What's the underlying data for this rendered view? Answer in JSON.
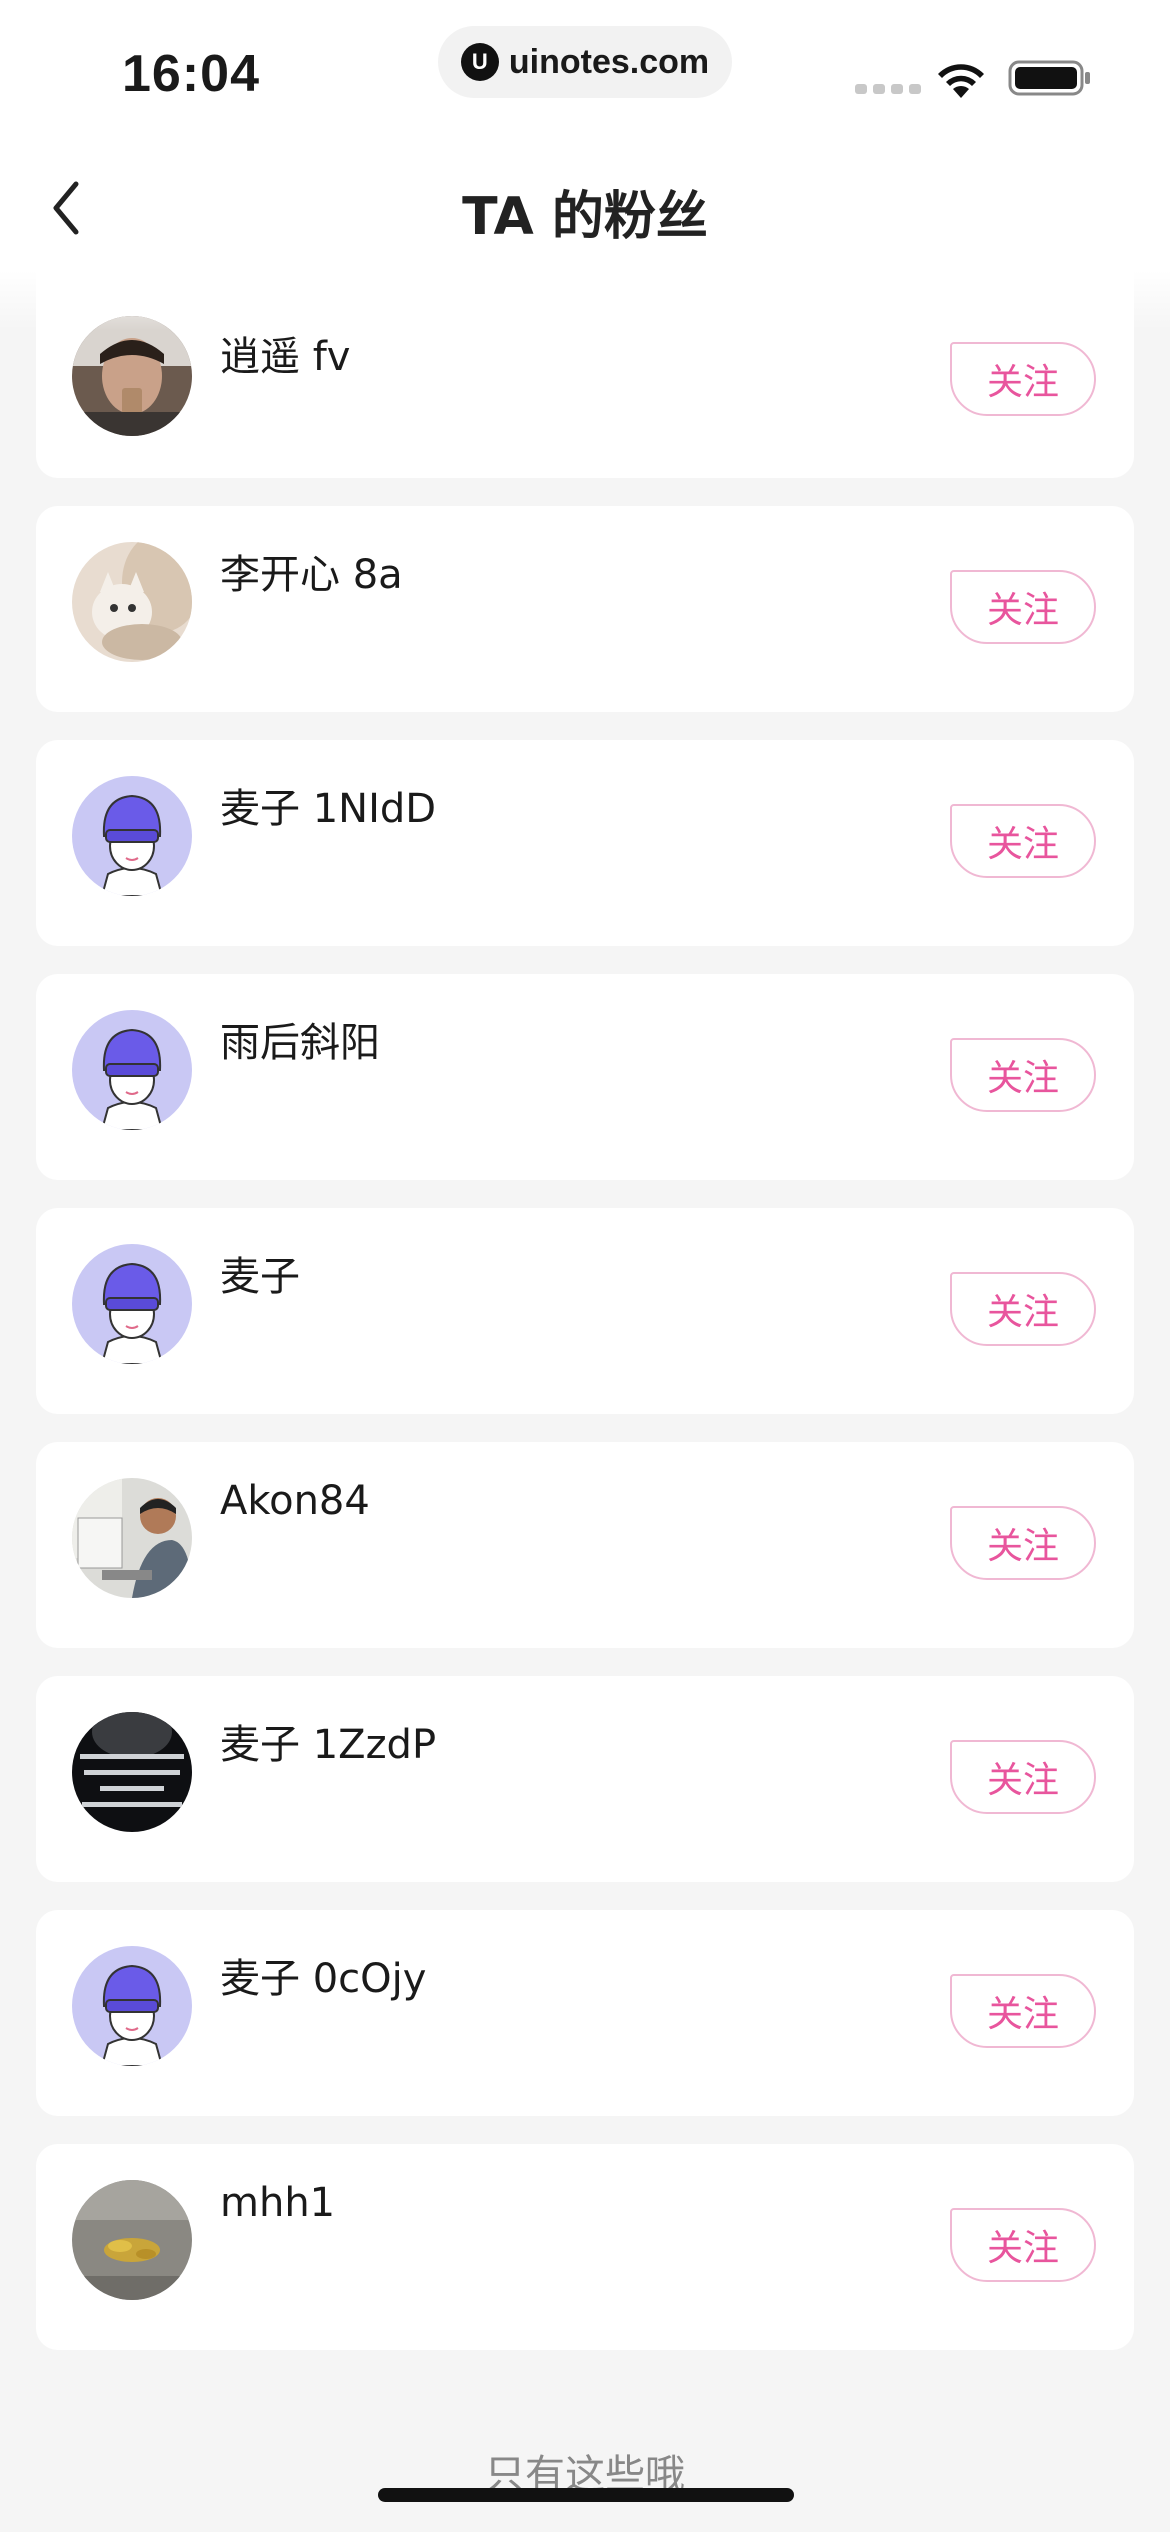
{
  "status_bar": {
    "time": "16:04",
    "url": "uinotes.com",
    "url_logo": "U"
  },
  "header": {
    "title": "TA 的粉丝",
    "back_icon": "chevron-left-icon"
  },
  "fans": [
    {
      "name": "逍遥 fv",
      "follow_label": "关注",
      "avatar": "photo-person"
    },
    {
      "name": "李开心 8a",
      "follow_label": "关注",
      "avatar": "photo-cat"
    },
    {
      "name": "麦子 1NIdD",
      "follow_label": "关注",
      "avatar": "default-cartoon"
    },
    {
      "name": "雨后斜阳",
      "follow_label": "关注",
      "avatar": "default-cartoon"
    },
    {
      "name": "麦子",
      "follow_label": "关注",
      "avatar": "default-cartoon"
    },
    {
      "name": "Akon84",
      "follow_label": "关注",
      "avatar": "photo-person-desk"
    },
    {
      "name": "麦子 1ZzdP",
      "follow_label": "关注",
      "avatar": "photo-dark-text"
    },
    {
      "name": "麦子 0cOjy",
      "follow_label": "关注",
      "avatar": "default-cartoon"
    },
    {
      "name": "mhh1",
      "follow_label": "关注",
      "avatar": "photo-leaves"
    }
  ],
  "footer": {
    "end_text": "只有这些哦"
  },
  "colors": {
    "accent": "#e8559d",
    "follow_border": "#f0b8d3",
    "background": "#f5f5f5"
  }
}
